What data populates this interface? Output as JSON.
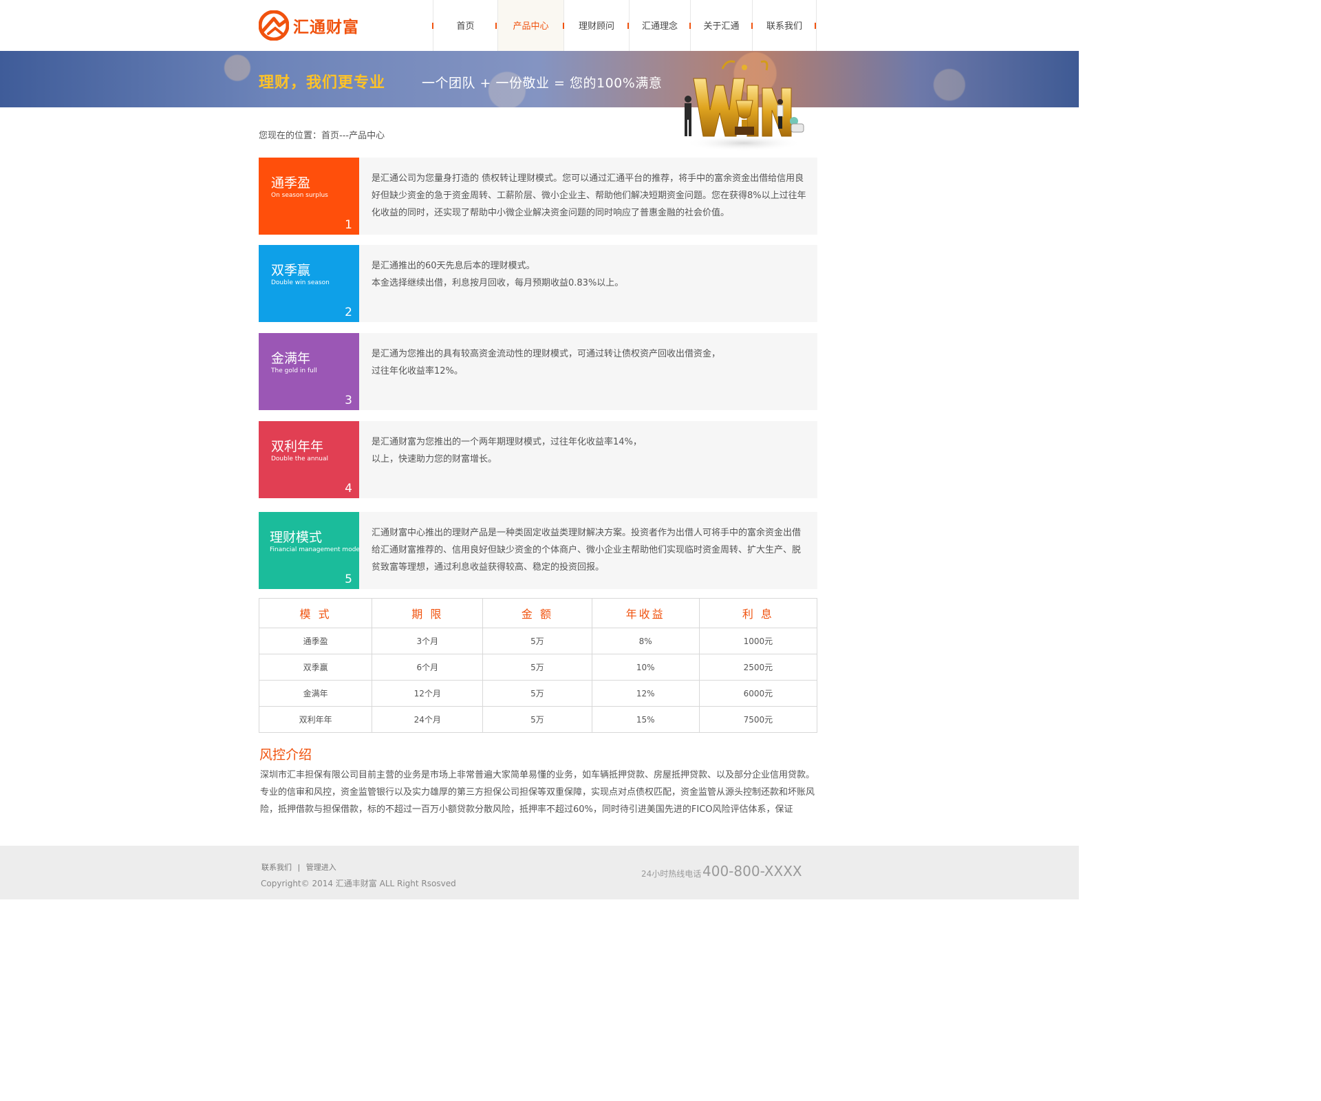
{
  "brand": {
    "name": "汇通财富",
    "color": "#f0520e"
  },
  "nav": {
    "items": [
      {
        "label": "首页",
        "active": false
      },
      {
        "label": "产品中心",
        "active": true
      },
      {
        "label": "理财顾问",
        "active": false
      },
      {
        "label": "汇通理念",
        "active": false
      },
      {
        "label": "关于汇通",
        "active": false
      },
      {
        "label": "联系我们",
        "active": false
      }
    ]
  },
  "banner": {
    "slogan": "理财，我们更专业",
    "tagline": "一个团队 + 一份敬业 = 您的100%满意",
    "art_icon": "win-trophy-illustration"
  },
  "breadcrumb": "您现在的位置：首页---产品中心",
  "products": [
    {
      "name": "通季盈",
      "name_en": "On season surplus",
      "num": "1",
      "color": "#ff4f0b",
      "desc": [
        "是汇通公司为您量身打造的 债权转让理财模式。您可以通过汇通平台的推荐，将手中的富余资金出借给信用良好但缺少资金的急于资金周转、工薪阶层、微小企业主、帮助他们解决短期资金问题。您在获得8%以上过往年化收益的同时，还实现了帮助中小微企业解决资金问题的同时响应了普惠金融的社会价值。"
      ]
    },
    {
      "name": "双季赢",
      "name_en": "Double win season",
      "num": "2",
      "color": "#0ea0e8",
      "desc": [
        "是汇通推出的60天先息后本的理财模式。",
        "本金选择继续出借，利息按月回收，每月预期收益0.83%以上。"
      ]
    },
    {
      "name": "金满年",
      "name_en": "The gold in full",
      "num": "3",
      "color": "#9b57b5",
      "desc": [
        "是汇通为您推出的具有较高资金流动性的理财模式，可通过转让债权资产回收出借资金，",
        "过往年化收益率12%。"
      ]
    },
    {
      "name": "双利年年",
      "name_en": "Double the annual",
      "num": "4",
      "color": "#e13f53",
      "desc": [
        "是汇通财富为您推出的一个两年期理财模式，过往年化收益率14%，",
        "以上，快速助力您的财富增长。"
      ]
    },
    {
      "name": "理财模式",
      "name_en": "Financial management mode",
      "num": "5",
      "color": "#1bbc9b",
      "desc": [
        "汇通财富中心推出的理财产品是一种类固定收益类理财解决方案。投资者作为出借人可将手中的富余资金出借给汇通财富推荐的、信用良好但缺少资金的个体商户、微小企业主帮助他们实现临时资金周转、扩大生产、脱贫致富等理想，通过利息收益获得较高、稳定的投资回报。"
      ]
    }
  ],
  "table": {
    "headers": [
      "模 式",
      "期 限",
      "金 额",
      "年收益",
      "利 息"
    ],
    "rows": [
      [
        "通季盈",
        "3个月",
        "5万",
        "8%",
        "1000元"
      ],
      [
        "双季赢",
        "6个月",
        "5万",
        "10%",
        "2500元"
      ],
      [
        "金满年",
        "12个月",
        "5万",
        "12%",
        "6000元"
      ],
      [
        "双利年年",
        "24个月",
        "5万",
        "15%",
        "7500元"
      ]
    ]
  },
  "risk": {
    "title": "风控介绍",
    "text": "深圳市汇丰担保有限公司目前主营的业务是市场上非常普遍大家简单易懂的业务，如车辆抵押贷款、房屋抵押贷款、以及部分企业信用贷款。专业的信审和风控，资金监管银行以及实力雄厚的第三方担保公司担保等双重保障，实现点对点债权匹配，资金监管从源头控制还款和坏账风险，抵押借款与担保借款，标的不超过一百万小额贷款分散风险，抵押率不超过60%，同时待引进美国先进的FICO风险评估体系，保证"
  },
  "footer": {
    "link_contact": "联系我们",
    "separator": "|",
    "link_admin": "管理进入",
    "copyright": "Copyright© 2014 汇通丰财富 ALL Right Rsosved",
    "hotline_label": "24小时热线电话",
    "hotline_number": "400-800-XXXX"
  }
}
